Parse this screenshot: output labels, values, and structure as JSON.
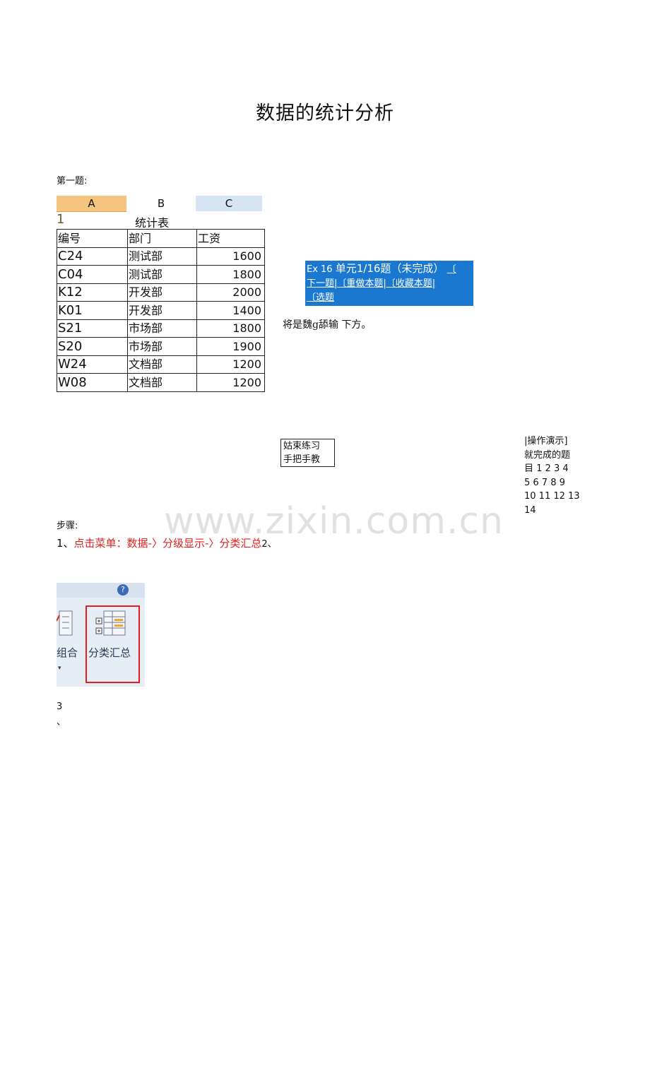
{
  "title": "数据的统计分析",
  "question_label": "第一题:",
  "sheet": {
    "col_headers": [
      "A",
      "B",
      "C"
    ],
    "row1_number": "1",
    "table_title": "统计表",
    "headers": [
      "编号",
      "部门",
      "工资"
    ],
    "rows": [
      [
        "C24",
        "测试部",
        "1600"
      ],
      [
        "C04",
        "测试部",
        "1800"
      ],
      [
        "K12",
        "开发部",
        "2000"
      ],
      [
        "K01",
        "开发部",
        "1400"
      ],
      [
        "S21",
        "市场部",
        "1800"
      ],
      [
        "S20",
        "市场部",
        "1900"
      ],
      [
        "W24",
        "文档部",
        "1200"
      ],
      [
        "W08",
        "文档部",
        "1200"
      ]
    ]
  },
  "nav": {
    "prefix": "Ex 16",
    "title": "单元1/16题（未完成）",
    "bracket_open": "〔",
    "next": "下一题|",
    "redo": "〔重做本题|",
    "fav": "〔收藏本题|",
    "select": "〔选题"
  },
  "nav_note": "将是魏g舔输  下方。",
  "end_box": {
    "line1": "姑束练习",
    "line2": "手把手教"
  },
  "side": {
    "line1": "|操作演示]",
    "line2": "就完成的题",
    "line3": "目 1 2 3 4",
    "line4": "5 6 7 8 9",
    "line5": "10  11  12  13",
    "line6": "14"
  },
  "watermark": "www.zixin.com.cn",
  "steps_label": "步骤:",
  "step1": {
    "num": "1、",
    "text": "点击菜单：数据-〉分级显示-〉分类汇总",
    "suffix": "2、"
  },
  "ribbon": {
    "help": "?",
    "label_group": "组合",
    "label_subtotal": "分类汇总",
    "caret": "▾"
  },
  "step3": {
    "num": "3",
    "mark": "、"
  }
}
